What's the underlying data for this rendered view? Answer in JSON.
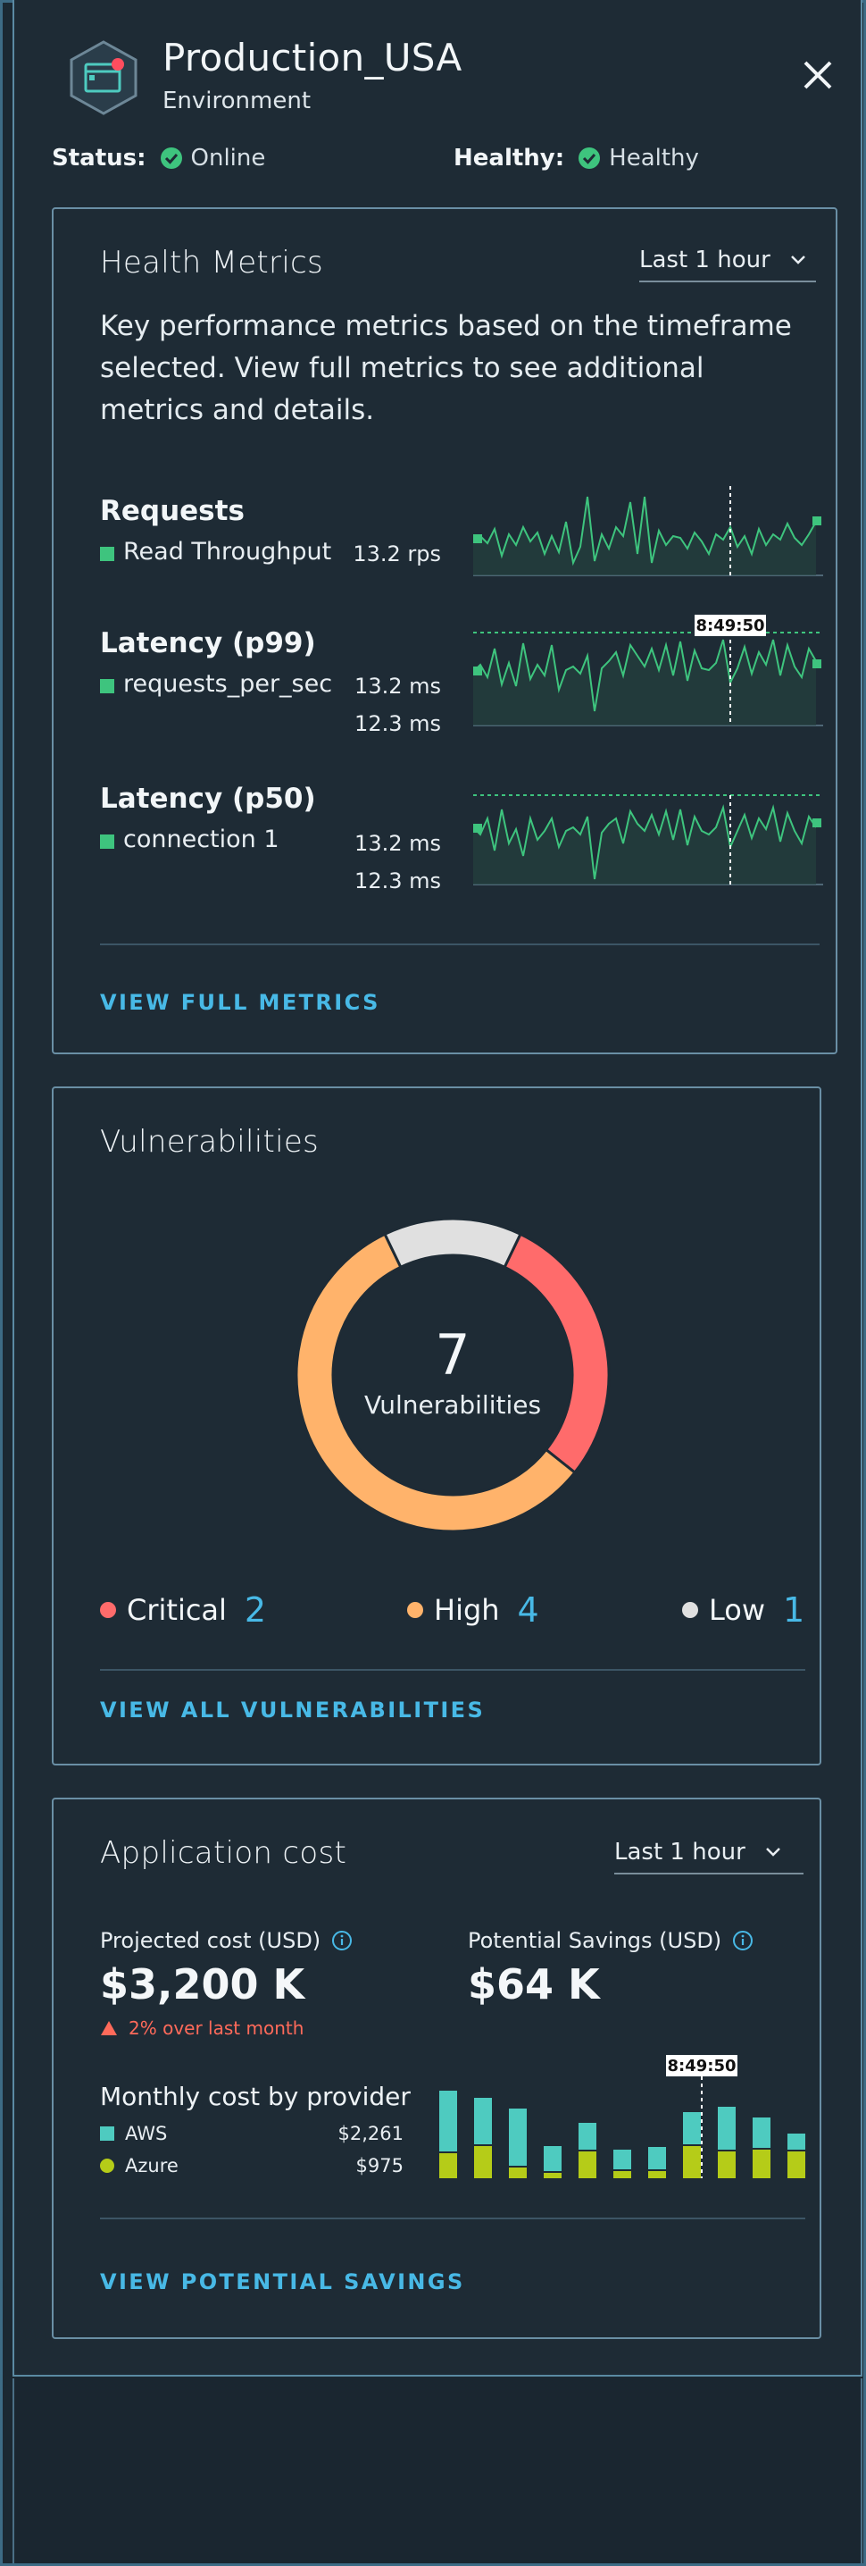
{
  "header": {
    "title": "Production_USA",
    "subtitle": "Environment",
    "status_label": "Status:",
    "status_value": "Online",
    "healthy_label": "Healthy:",
    "healthy_value": "Healthy",
    "status_color": "#3ec47e"
  },
  "health": {
    "title": "Health Metrics",
    "timeframe": "Last 1 hour",
    "description": "Key performance metrics based on the timeframe selected. View full metrics to see additional metrics and details.",
    "metrics": [
      {
        "name": "Requests",
        "legend": "Read Throughput",
        "value": "13.2 rps"
      },
      {
        "name": "Latency (p99)",
        "legend": "requests_per_sec",
        "value": "13.2 ms",
        "value2": "12.3 ms",
        "tooltip": "8:49:50"
      },
      {
        "name": "Latency (p50)",
        "legend": "connection 1",
        "value": "13.2 ms",
        "value2": "12.3 ms"
      }
    ],
    "link": "VIEW FULL METRICS",
    "line_color": "#3ec47e"
  },
  "vulnerabilities": {
    "title": "Vulnerabilities",
    "total": "7",
    "total_label": "Vulnerabilities",
    "items": [
      {
        "label": "Critical",
        "count": "2",
        "color": "#ff6b6b"
      },
      {
        "label": "High",
        "count": "4",
        "color": "#ffb36b"
      },
      {
        "label": "Low",
        "count": "1",
        "color": "#e0e0e0"
      }
    ],
    "link": "VIEW ALL VULNERABILITIES"
  },
  "cost": {
    "title": "Application cost",
    "timeframe": "Last 1 hour",
    "projected_label": "Projected cost (USD)",
    "projected_value": "$3,200 K",
    "trend": "2% over last month",
    "savings_label": "Potential Savings (USD)",
    "savings_value": "$64 K",
    "monthly_title": "Monthly cost by provider",
    "providers": [
      {
        "name": "AWS",
        "value": "$2,261",
        "color": "#4ecbc0"
      },
      {
        "name": "Azure",
        "value": "$975",
        "color": "#b5cc18"
      }
    ],
    "tooltip": "8:49:50",
    "link": "VIEW POTENTIAL SAVINGS"
  },
  "chart_data": {
    "type": "bar",
    "title": "Monthly cost by provider",
    "series": [
      {
        "name": "AWS",
        "values": [
          68,
          52,
          64,
          28,
          30,
          22,
          25,
          36,
          48,
          34,
          18
        ]
      },
      {
        "name": "Azure",
        "values": [
          28,
          36,
          12,
          6,
          30,
          8,
          8,
          36,
          30,
          32,
          30
        ]
      }
    ],
    "stacked": true
  }
}
